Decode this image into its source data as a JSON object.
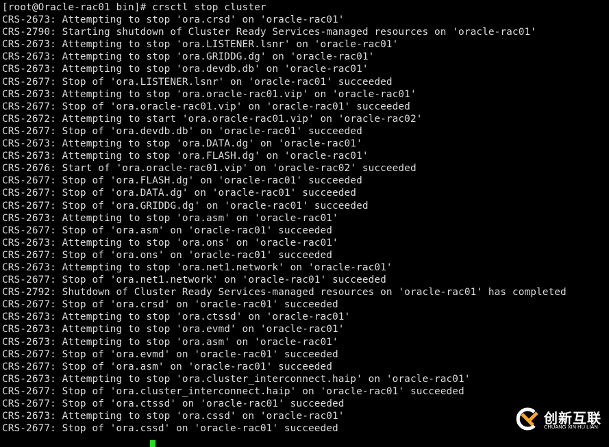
{
  "terminal": {
    "lines": [
      "[root@Oracle-rac01 bin]# crsctl stop cluster",
      "CRS-2673: Attempting to stop 'ora.crsd' on 'oracle-rac01'",
      "CRS-2790: Starting shutdown of Cluster Ready Services-managed resources on 'oracle-rac01'",
      "CRS-2673: Attempting to stop 'ora.LISTENER.lsnr' on 'oracle-rac01'",
      "CRS-2673: Attempting to stop 'ora.GRIDDG.dg' on 'oracle-rac01'",
      "CRS-2673: Attempting to stop 'ora.devdb.db' on 'oracle-rac01'",
      "CRS-2677: Stop of 'ora.LISTENER.lsnr' on 'oracle-rac01' succeeded",
      "CRS-2673: Attempting to stop 'ora.oracle-rac01.vip' on 'oracle-rac01'",
      "CRS-2677: Stop of 'ora.oracle-rac01.vip' on 'oracle-rac01' succeeded",
      "CRS-2672: Attempting to start 'ora.oracle-rac01.vip' on 'oracle-rac02'",
      "CRS-2677: Stop of 'ora.devdb.db' on 'oracle-rac01' succeeded",
      "CRS-2673: Attempting to stop 'ora.DATA.dg' on 'oracle-rac01'",
      "CRS-2673: Attempting to stop 'ora.FLASH.dg' on 'oracle-rac01'",
      "CRS-2676: Start of 'ora.oracle-rac01.vip' on 'oracle-rac02' succeeded",
      "CRS-2677: Stop of 'ora.FLASH.dg' on 'oracle-rac01' succeeded",
      "CRS-2677: Stop of 'ora.DATA.dg' on 'oracle-rac01' succeeded",
      "CRS-2677: Stop of 'ora.GRIDDG.dg' on 'oracle-rac01' succeeded",
      "CRS-2673: Attempting to stop 'ora.asm' on 'oracle-rac01'",
      "CRS-2677: Stop of 'ora.asm' on 'oracle-rac01' succeeded",
      "CRS-2673: Attempting to stop 'ora.ons' on 'oracle-rac01'",
      "CRS-2677: Stop of 'ora.ons' on 'oracle-rac01' succeeded",
      "CRS-2673: Attempting to stop 'ora.net1.network' on 'oracle-rac01'",
      "CRS-2677: Stop of 'ora.net1.network' on 'oracle-rac01' succeeded",
      "CRS-2792: Shutdown of Cluster Ready Services-managed resources on 'oracle-rac01' has completed",
      "CRS-2677: Stop of 'ora.crsd' on 'oracle-rac01' succeeded",
      "CRS-2673: Attempting to stop 'ora.ctssd' on 'oracle-rac01'",
      "CRS-2673: Attempting to stop 'ora.evmd' on 'oracle-rac01'",
      "CRS-2673: Attempting to stop 'ora.asm' on 'oracle-rac01'",
      "CRS-2677: Stop of 'ora.evmd' on 'oracle-rac01' succeeded",
      "CRS-2677: Stop of 'ora.asm' on 'oracle-rac01' succeeded",
      "CRS-2673: Attempting to stop 'ora.cluster_interconnect.haip' on 'oracle-rac01'",
      "CRS-2677: Stop of 'ora.cluster_interconnect.haip' on 'oracle-rac01' succeeded",
      "CRS-2677: Stop of 'ora.ctssd' on 'oracle-rac01' succeeded",
      "CRS-2673: Attempting to stop 'ora.cssd' on 'oracle-rac01'",
      "CRS-2677: Stop of 'ora.cssd' on 'oracle-rac01' succeeded"
    ],
    "colors": {
      "background": "#000000",
      "text": "#dcdcdc",
      "cursor": "#22dd22"
    }
  },
  "watermark": {
    "name_cn": "创新互联",
    "name_en": "CHUANG XIN HU LIAN",
    "icon": "cx-logo-icon",
    "colors": {
      "ring": "#ffffff",
      "x": "#f5a623"
    }
  }
}
